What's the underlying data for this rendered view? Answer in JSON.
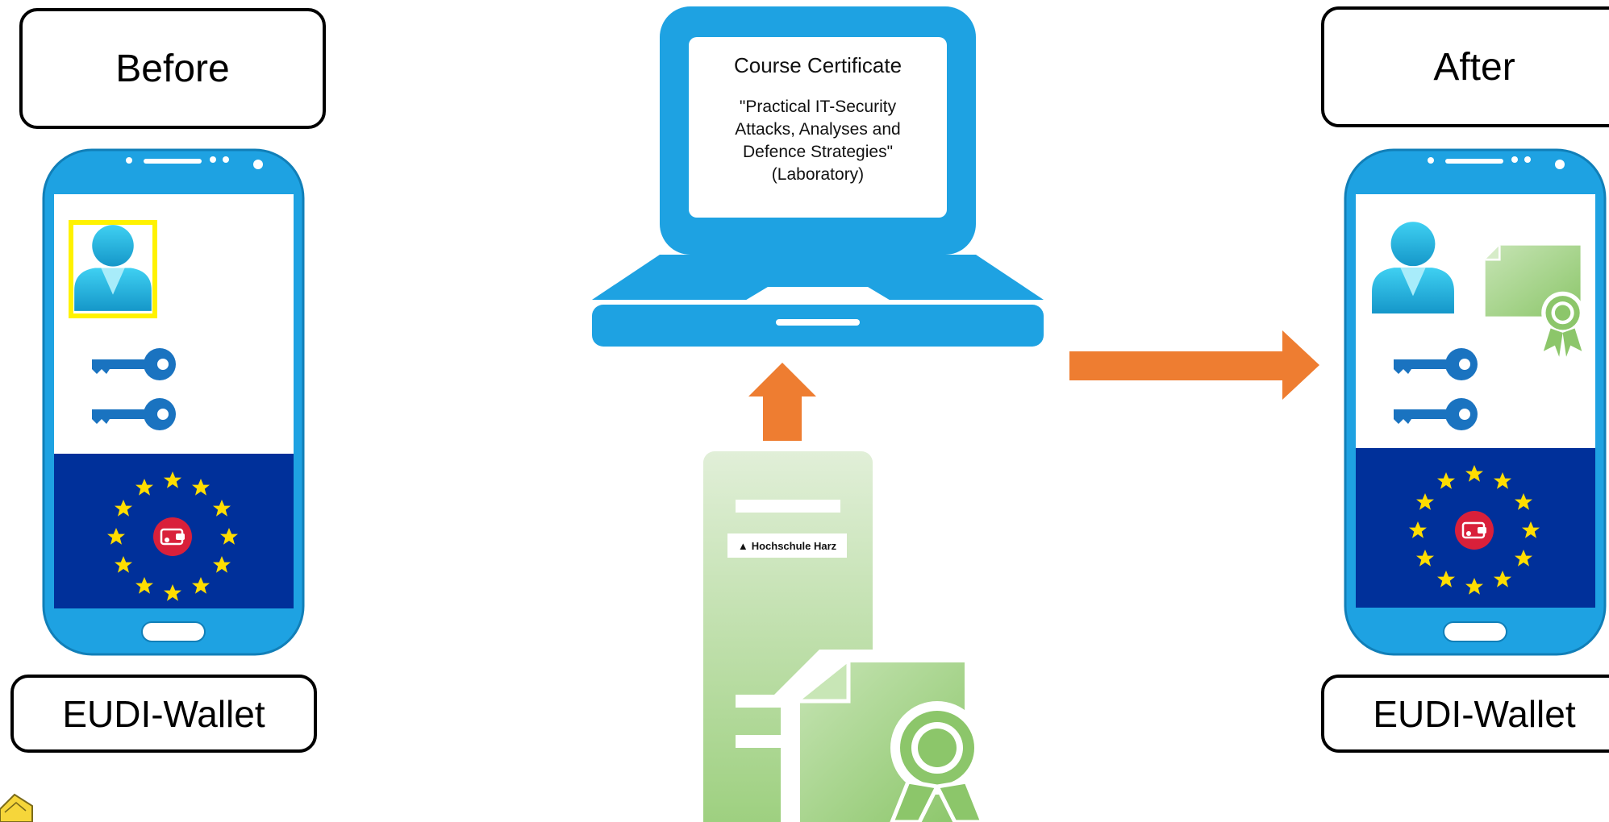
{
  "labels": {
    "before": "Before",
    "after": "After",
    "wallet_left": "EUDI-Wallet",
    "wallet_right": "EUDI-Wallet"
  },
  "certificate": {
    "title": "Course Certificate",
    "lines": [
      "\"Practical IT-Security",
      "Attacks, Analyses and",
      "Defence Strategies\"",
      "(Laboratory)"
    ]
  },
  "issuer": {
    "name": "Hochschule Harz",
    "glyph": "▲"
  },
  "icons": {
    "laptop": "laptop-icon",
    "server": "server-icon",
    "user": "user-icon",
    "key": "key-icon",
    "certificate": "certificate-icon",
    "wallet": "wallet-icon",
    "eu_stars": "eu-flag-icon",
    "arrow": "arrow-icon"
  },
  "colors": {
    "device_blue": "#1ea2e2",
    "eu_blue": "#00309a",
    "eu_star": "#ffdd00",
    "arrow_orange": "#ee7d31",
    "cert_green": "#9ed080",
    "highlight_yellow": "#fff200",
    "key_blue": "#1a73c0",
    "user_cyan": "#2ec4ea",
    "wallet_red": "#d9203a"
  }
}
